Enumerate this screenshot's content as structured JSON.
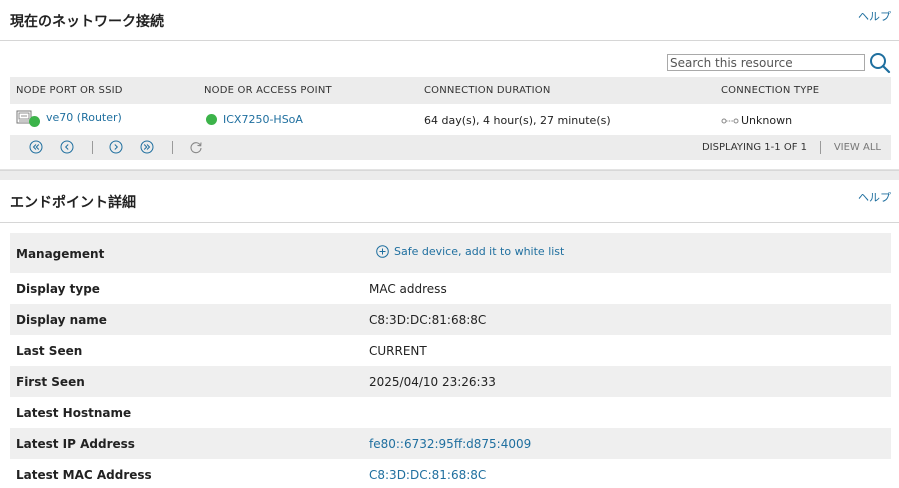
{
  "current_connection": {
    "title": "現在のネットワーク接続",
    "help_label": "ヘルプ",
    "search": {
      "placeholder": "Search this resource",
      "value": ""
    },
    "columns": [
      "NODE PORT OR SSID",
      "NODE OR ACCESS POINT",
      "CONNECTION DURATION",
      "CONNECTION TYPE"
    ],
    "rows": [
      {
        "port": "ve70 (Router)",
        "node": "ICX7250-HSoA",
        "duration": "64 day(s), 4 hour(s), 27 minute(s)",
        "type": "Unknown"
      }
    ],
    "footer": {
      "display_count": "DISPLAYING 1-1 OF 1",
      "view_all": "VIEW ALL"
    }
  },
  "endpoint_details": {
    "title": "エンドポイント詳細",
    "help_label": "ヘルプ",
    "management_label": "Management",
    "management_action": "Safe device, add it to white list",
    "rows": [
      {
        "label": "Display type",
        "value": "MAC address",
        "is_link": false
      },
      {
        "label": "Display name",
        "value": "C8:3D:DC:81:68:8C",
        "is_link": false
      },
      {
        "label": "Last Seen",
        "value": "CURRENT",
        "is_link": false
      },
      {
        "label": "First Seen",
        "value": "2025/04/10 23:26:33",
        "is_link": false
      },
      {
        "label": "Latest Hostname",
        "value": "",
        "is_link": false
      },
      {
        "label": "Latest IP Address",
        "value": "fe80::6732:95ff:d875:4009",
        "is_link": true
      },
      {
        "label": "Latest MAC Address",
        "value": "C8:3D:DC:81:68:8C",
        "is_link": true
      }
    ]
  },
  "colors": {
    "link": "#1f6f9f",
    "status_up": "#3cb34a",
    "row_shade": "#efefef",
    "header_bg": "#ececec"
  }
}
